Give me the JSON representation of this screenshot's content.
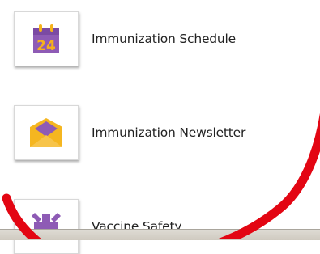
{
  "menu": {
    "items": [
      {
        "label": "Immunization Schedule",
        "icon": "calendar-24-icon",
        "calendar_number": "24"
      },
      {
        "label": "Immunization Newsletter",
        "icon": "envelope-icon"
      },
      {
        "label": "Vaccine Safety",
        "icon": "vaccine-safety-icon"
      }
    ]
  },
  "colors": {
    "calendar": "#8e5bb5",
    "calendar_number": "#f6b21a",
    "envelope": "#f5b620",
    "envelope_letter": "#8e5bb5",
    "vaccine": "#8e5bb5",
    "annotation": "#e30613"
  }
}
